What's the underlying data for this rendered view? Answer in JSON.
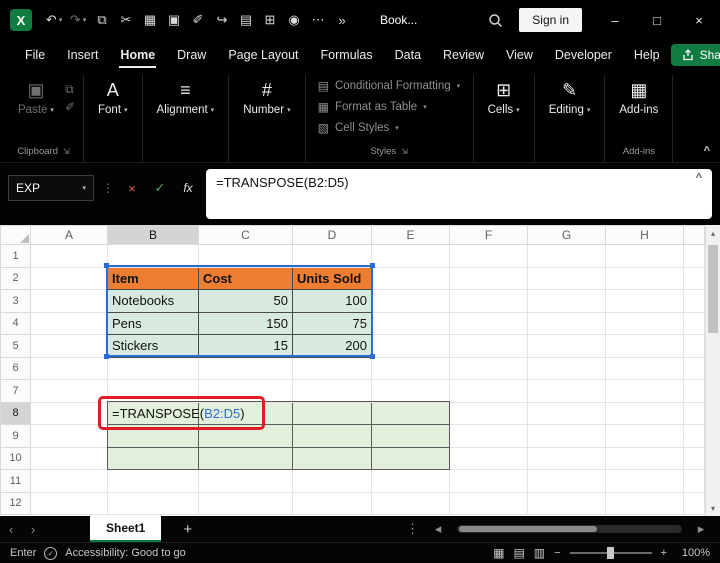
{
  "colors": {
    "titlebar_bg": "#000000",
    "accent_green": "#107C41",
    "table_header_orange": "#ED7D31",
    "table_fill_green": "#D8EADF",
    "spill_fill_green": "#E2EFDA",
    "reference_blue": "#2B6BD8",
    "annotation_red": "#E01B24"
  },
  "titlebar": {
    "title": "Book...",
    "sign_in": "Sign in",
    "icons": {
      "logo": "X",
      "undo": "↶",
      "redo": "↷",
      "caret": "▾",
      "overflow": "»",
      "minimize": "–",
      "maximize": "□",
      "close": "×",
      "qat": [
        {
          "name": "copy-icon",
          "glyph": "⧉"
        },
        {
          "name": "cut-icon",
          "glyph": "✂"
        },
        {
          "name": "picture-icon",
          "glyph": "▦"
        },
        {
          "name": "clipboard-icon",
          "glyph": "▣"
        },
        {
          "name": "draw-icon",
          "glyph": "✐"
        },
        {
          "name": "redo-curve-icon",
          "glyph": "↪"
        },
        {
          "name": "document-icon",
          "glyph": "▤"
        },
        {
          "name": "grid-icon",
          "glyph": "⊞"
        },
        {
          "name": "camera-icon",
          "glyph": "◉"
        },
        {
          "name": "more-icon",
          "glyph": "⋯"
        }
      ]
    }
  },
  "ribbon": {
    "tabs": [
      "File",
      "Insert",
      "Home",
      "Draw",
      "Page Layout",
      "Formulas",
      "Data",
      "Review",
      "View",
      "Developer",
      "Help"
    ],
    "active_tab": "Home",
    "share_label": "Share",
    "caret": "▾",
    "launcher": "⇲",
    "collapse": "^",
    "groups": {
      "clipboard": {
        "paste": "Paste",
        "paste_icon": "▣",
        "copy_icon": "⧉",
        "painter_icon": "✐",
        "label": "Clipboard"
      },
      "font": {
        "label": "Font",
        "icon": "A"
      },
      "alignment": {
        "label": "Alignment",
        "icon": "≡"
      },
      "number": {
        "label": "Number",
        "icon": "#"
      },
      "styles": {
        "items": [
          {
            "label": "Conditional Formatting",
            "icon": "▤"
          },
          {
            "label": "Format as Table",
            "icon": "▦"
          },
          {
            "label": "Cell Styles",
            "icon": "▧"
          }
        ],
        "label": "Styles"
      },
      "cells": {
        "label": "Cells",
        "icon": "⊞"
      },
      "editing": {
        "label": "Editing",
        "icon": "✎"
      },
      "addins": {
        "button": "Add-ins",
        "label": "Add-ins",
        "icon": "▦"
      }
    }
  },
  "formula_bar": {
    "name_box": "EXP",
    "dots": "⋮",
    "cancel": "×",
    "enter": "✓",
    "fx": "fx",
    "formula": "=TRANSPOSE(B2:D5)",
    "collapse": "^"
  },
  "sheet": {
    "columns": [
      "A",
      "B",
      "C",
      "D",
      "E",
      "F",
      "G",
      "H"
    ],
    "rows": [
      "1",
      "2",
      "3",
      "4",
      "5",
      "6",
      "7",
      "8",
      "9",
      "10",
      "11",
      "12"
    ],
    "table": {
      "headers": [
        "Item",
        "Cost",
        "Units Sold"
      ],
      "data": [
        [
          "Notebooks",
          "50",
          "100"
        ],
        [
          "Pens",
          "150",
          "75"
        ],
        [
          "Stickers",
          "15",
          "200"
        ]
      ]
    },
    "spill_formula": {
      "prefix": "=TRANSPOSE(",
      "ref": "B2:D5",
      "suffix": ")"
    }
  },
  "sheet_bar": {
    "tab": "Sheet1",
    "add": "+",
    "nav_left": "‹",
    "nav_right": "›",
    "menu": "⋮",
    "scroll_left": "◂",
    "scroll_right": "▸"
  },
  "status_bar": {
    "mode": "Enter",
    "accessibility_icon": "✓",
    "accessibility": "Accessibility: Good to go",
    "views": [
      {
        "name": "normal-view-icon",
        "glyph": "▦"
      },
      {
        "name": "page-layout-view-icon",
        "glyph": "▤"
      },
      {
        "name": "page-break-view-icon",
        "glyph": "▥"
      }
    ],
    "zoom_out": "−",
    "zoom_in": "+",
    "zoom_level": "100%"
  },
  "scrollbars": {
    "up": "▴",
    "down": "▾"
  }
}
